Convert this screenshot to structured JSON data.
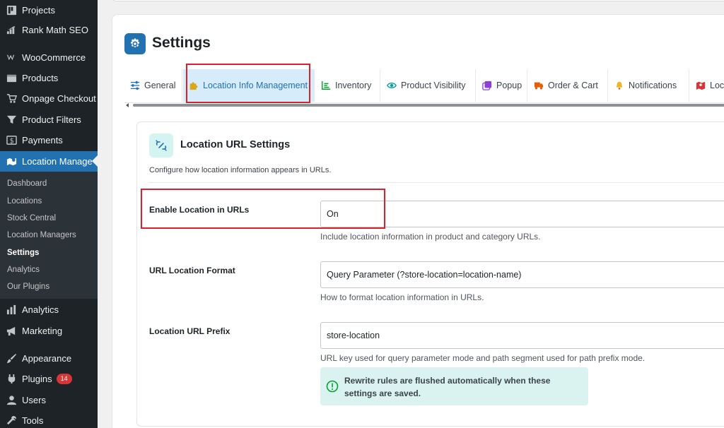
{
  "sidebar": {
    "items": [
      {
        "label": "Projects",
        "icon": "projects-icon"
      },
      {
        "label": "Rank Math SEO",
        "icon": "rank-math-icon"
      },
      {
        "label": "WooCommerce",
        "icon": "woocommerce-icon"
      },
      {
        "label": "Products",
        "icon": "products-icon"
      },
      {
        "label": "Onpage Checkout",
        "icon": "cart-icon"
      },
      {
        "label": "Product Filters",
        "icon": "filter-icon"
      },
      {
        "label": "Payments",
        "icon": "payments-icon"
      },
      {
        "label": "Location Manage",
        "icon": "location-icon"
      },
      {
        "label": "Analytics",
        "icon": "analytics-icon"
      },
      {
        "label": "Marketing",
        "icon": "megaphone-icon"
      },
      {
        "label": "Appearance",
        "icon": "brush-icon"
      },
      {
        "label": "Plugins",
        "icon": "plug-icon",
        "badge": "14"
      },
      {
        "label": "Users",
        "icon": "users-icon"
      },
      {
        "label": "Tools",
        "icon": "wrench-icon"
      }
    ],
    "submenu": [
      "Dashboard",
      "Locations",
      "Stock Central",
      "Location Managers",
      "Settings",
      "Analytics",
      "Our Plugins"
    ]
  },
  "page": {
    "title": "Settings"
  },
  "tabs": [
    {
      "label": "General",
      "icon": "sliders-icon"
    },
    {
      "label": "Location Info Management",
      "icon": "puzzle-icon"
    },
    {
      "label": "Inventory",
      "icon": "chart-bar-icon"
    },
    {
      "label": "Product Visibility",
      "icon": "eye-icon"
    },
    {
      "label": "Popup",
      "icon": "popup-icon"
    },
    {
      "label": "Order & Cart",
      "icon": "truck-icon"
    },
    {
      "label": "Notifications",
      "icon": "bell-icon"
    },
    {
      "label": "Loc",
      "icon": "map-icon"
    }
  ],
  "card": {
    "title": "Location URL Settings",
    "description": "Configure how location information appears in URLs."
  },
  "fields": {
    "enable": {
      "label": "Enable Location in URLs",
      "value": "On",
      "help": "Include location information in product and category URLs."
    },
    "format": {
      "label": "URL Location Format",
      "value": "Query Parameter (?store-location=location-name)",
      "help": "How to format location information in URLs."
    },
    "prefix": {
      "label": "Location URL Prefix",
      "value": "store-location",
      "help": "URL key used for query parameter mode and path segment used for path prefix mode."
    }
  },
  "notice": {
    "text": "Rewrite rules are flushed automatically when these settings are saved."
  },
  "colors": {
    "sidebar_bg": "#1d2327",
    "accent": "#2271b1",
    "highlight": "#d9202b",
    "notice_bg": "#daf3f1"
  }
}
